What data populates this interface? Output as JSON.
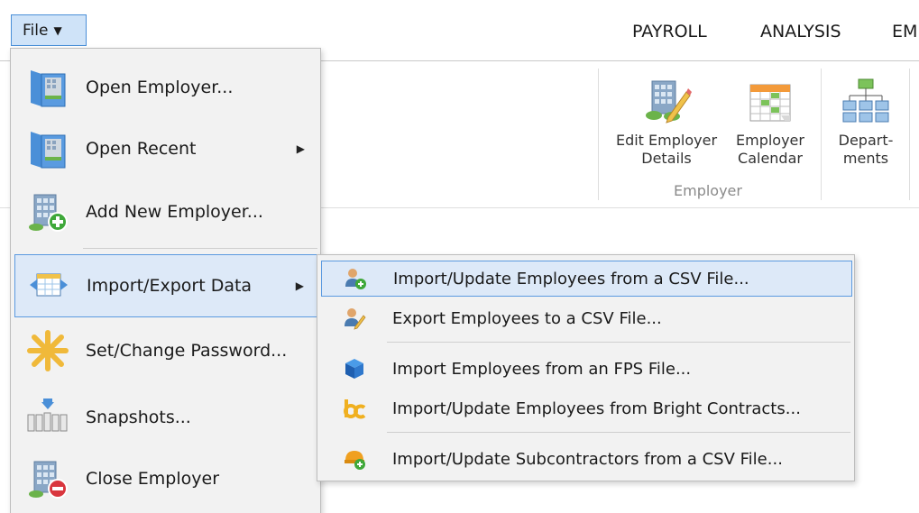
{
  "topbar": {
    "file_label": "File",
    "tabs": [
      "PAYROLL",
      "ANALYSIS",
      "EM"
    ]
  },
  "ribbon": {
    "buttons": [
      {
        "line1": "Edit Employer",
        "line2": "Details",
        "icon": "edit-employer-icon"
      },
      {
        "line1": "Employer",
        "line2": "Calendar",
        "icon": "calendar-icon"
      },
      {
        "line1": "Depart-",
        "line2": "ments",
        "icon": "departments-icon"
      }
    ],
    "group_label": "Employer"
  },
  "file_menu": {
    "items": [
      {
        "label": "Open Employer...",
        "icon": "open-employer-icon"
      },
      {
        "label": "Open Recent",
        "icon": "open-recent-icon",
        "has_submenu": true
      },
      {
        "label": "Add New Employer...",
        "icon": "add-employer-icon"
      },
      {
        "label": "Import/Export Data",
        "icon": "import-export-icon",
        "has_submenu": true,
        "active": true
      },
      {
        "label": "Set/Change Password...",
        "icon": "password-icon"
      },
      {
        "label": "Snapshots...",
        "icon": "snapshots-icon"
      },
      {
        "label": "Close Employer",
        "icon": "close-employer-icon"
      }
    ]
  },
  "submenu": {
    "items": [
      {
        "label": "Import/Update Employees from a CSV File...",
        "icon": "import-employee-csv-icon",
        "active": true
      },
      {
        "label": "Export Employees to a CSV File...",
        "icon": "export-employee-csv-icon"
      },
      {
        "label": "Import Employees from an FPS File...",
        "icon": "fps-cube-icon"
      },
      {
        "label": "Import/Update Employees from Bright Contracts...",
        "icon": "bright-contracts-icon"
      },
      {
        "label": "Import/Update Subcontractors from a CSV File...",
        "icon": "subcontractor-icon"
      }
    ]
  },
  "colors": {
    "accent": "#4a8fd8",
    "highlight": "#dde9f8",
    "menu_bg": "#f2f2f2"
  }
}
